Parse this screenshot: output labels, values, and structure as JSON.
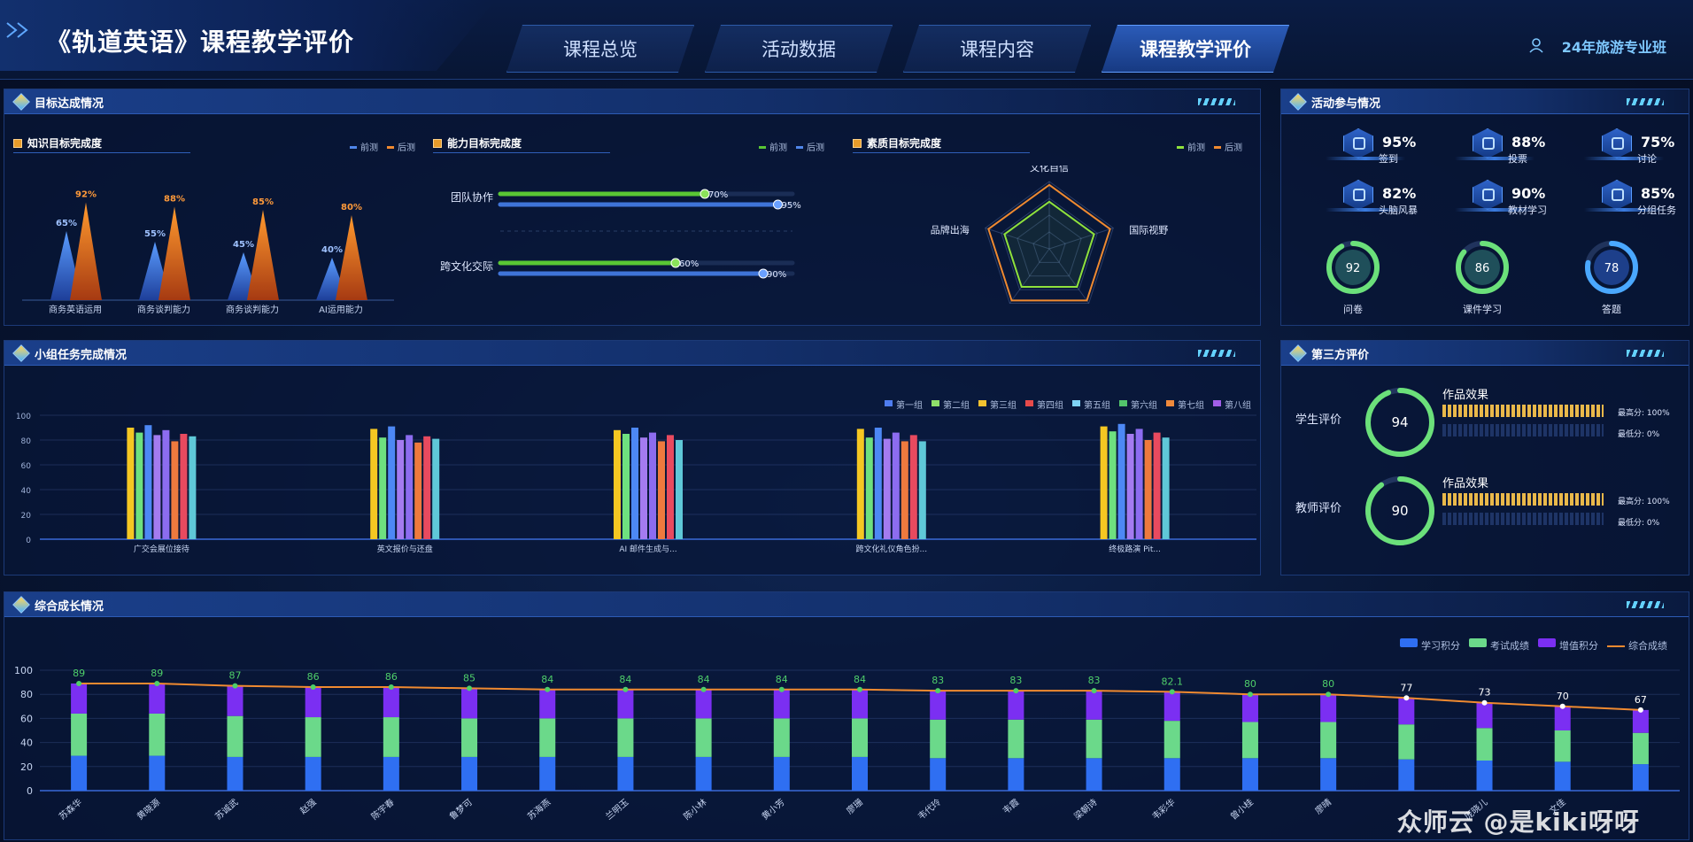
{
  "header": {
    "title": "《轨道英语》课程教学评价",
    "class_label": "24年旅游专业班",
    "tabs": [
      {
        "label": "课程总览"
      },
      {
        "label": "活动数据"
      },
      {
        "label": "课程内容"
      },
      {
        "label": "课程教学评价"
      }
    ]
  },
  "panels": {
    "goal": "目标达成情况",
    "activity": "活动参与情况",
    "group": "小组任务完成情况",
    "third": "第三方评价",
    "growth": "综合成长情况"
  },
  "knowledge": {
    "title": "知识目标完成度",
    "legend": [
      "前测",
      "后测"
    ],
    "chart_data": {
      "type": "bar",
      "categories": [
        "商务英语运用",
        "商务谈判能力",
        "商务谈判能力",
        "AI运用能力"
      ],
      "series": [
        {
          "name": "前测",
          "values": [
            65,
            55,
            45,
            40
          ]
        },
        {
          "name": "后测",
          "values": [
            92,
            88,
            85,
            80
          ]
        }
      ],
      "ylim": [
        0,
        100
      ]
    }
  },
  "ability": {
    "title": "能力目标完成度",
    "legend": [
      "前测",
      "后测"
    ],
    "chart_data": {
      "type": "bar",
      "categories": [
        "团队协作",
        "跨文化交际"
      ],
      "series": [
        {
          "name": "前测",
          "values": [
            70,
            60
          ]
        },
        {
          "name": "后测",
          "values": [
            95,
            90
          ]
        }
      ],
      "xlim": [
        0,
        100
      ]
    }
  },
  "quality": {
    "title": "素质目标完成度",
    "legend": [
      "前测",
      "后测"
    ],
    "chart_data": {
      "type": "radar",
      "indicators": [
        "文化自信",
        "国际视野",
        "",
        "",
        "品牌出海"
      ],
      "series": [
        {
          "name": "前测",
          "values": [
            70,
            70,
            70,
            70,
            70
          ]
        },
        {
          "name": "后测",
          "values": [
            95,
            95,
            95,
            95,
            95
          ]
        }
      ]
    }
  },
  "activity": {
    "stats": [
      {
        "value": "95%",
        "label": "签到",
        "icon": "signin-icon"
      },
      {
        "value": "88%",
        "label": "投票",
        "icon": "vote-icon"
      },
      {
        "value": "75%",
        "label": "讨论",
        "icon": "discussion-icon"
      },
      {
        "value": "82%",
        "label": "头脑风暴",
        "icon": "brainstorm-icon"
      },
      {
        "value": "90%",
        "label": "教材学习",
        "icon": "textbook-icon"
      },
      {
        "value": "85%",
        "label": "分组任务",
        "icon": "group-icon"
      }
    ],
    "rings": [
      {
        "value": "92",
        "label": "问卷",
        "level": 0.92
      },
      {
        "value": "86",
        "label": "课件学习",
        "level": 0.86
      },
      {
        "value": "78",
        "label": "答题",
        "level": 0.78
      }
    ]
  },
  "group_tasks": {
    "legend": [
      "第一组",
      "第二组",
      "第三组",
      "第四组",
      "第五组",
      "第六组",
      "第七组",
      "第八组"
    ],
    "colors": [
      "#4f7df0",
      "#8ee06a",
      "#f2c230",
      "#e74a4a",
      "#7fd3f5",
      "#52c46b",
      "#f08a3c",
      "#a15ee8"
    ],
    "bar_colors": [
      "#f5c722",
      "#6ee07f",
      "#4d88f5",
      "#a47bf0",
      "#8c6cf0",
      "#ee7a3e",
      "#e84a5f",
      "#5fc8d8"
    ],
    "chart_data": {
      "type": "bar",
      "categories": [
        "广交会展位接待",
        "英文报价与还盘",
        "AI 邮件生成与...",
        "跨文化礼仪角色扮...",
        "终极路演 Pit..."
      ],
      "series_values": [
        [
          90,
          86,
          92,
          84,
          88,
          79,
          85,
          83
        ],
        [
          89,
          82,
          91,
          80,
          84,
          78,
          83,
          81
        ],
        [
          88,
          85,
          90,
          82,
          86,
          79,
          84,
          80
        ],
        [
          89,
          82,
          90,
          81,
          86,
          79,
          84,
          79
        ],
        [
          91,
          87,
          93,
          85,
          89,
          80,
          86,
          82
        ]
      ],
      "yticks": [
        "100",
        "80",
        "60",
        "40",
        "20",
        "0"
      ],
      "ylim": [
        0,
        100
      ]
    }
  },
  "third_party": {
    "rows": [
      {
        "label": "学生评价",
        "score": "94",
        "level": 0.94,
        "metric": "作品效果",
        "max": "最高分: 100%",
        "min": "最低分: 0%"
      },
      {
        "label": "教师评价",
        "score": "90",
        "level": 0.9,
        "metric": "作品效果",
        "max": "最高分: 100%",
        "min": "最低分: 0%"
      }
    ]
  },
  "growth": {
    "legend": [
      "学习积分",
      "考试成绩",
      "增值积分",
      "综合成绩"
    ],
    "chart_data": {
      "type": "bar",
      "categories": [
        "苏森华",
        "黄晓源",
        "苏诚武",
        "赵强",
        "陈宇春",
        "鲁梦可",
        "苏海燕",
        "兰明玉",
        "陈小林",
        "黄小芳",
        "廖珊",
        "韦代玲",
        "韦霞",
        "梁朝诗",
        "韦彩华",
        "曾小桂",
        "廖晴",
        "",
        "庞晓儿",
        "文佳",
        ""
      ],
      "series": [
        {
          "name": "学习积分",
          "values": [
            29,
            29,
            28,
            28,
            28,
            28,
            28,
            28,
            28,
            28,
            28,
            27,
            27,
            27,
            27,
            27,
            27,
            26,
            25,
            24,
            22
          ]
        },
        {
          "name": "考试成绩",
          "values": [
            35,
            35,
            34,
            33,
            33,
            32,
            32,
            32,
            32,
            32,
            32,
            32,
            32,
            32,
            31,
            30,
            30,
            29,
            27,
            26,
            26
          ]
        },
        {
          "name": "增值积分",
          "values": [
            25,
            25,
            25,
            25,
            25,
            25,
            24,
            24,
            24,
            24,
            24,
            24,
            24,
            24,
            24,
            23,
            23,
            22,
            21,
            20,
            19
          ]
        },
        {
          "name": "综合成绩",
          "values": [
            89,
            89,
            87,
            86,
            86,
            85,
            84,
            84,
            84,
            84,
            84,
            83,
            83,
            83,
            82.1,
            80,
            80,
            77,
            73,
            70,
            67
          ]
        }
      ],
      "yticks": [
        "100",
        "80",
        "60",
        "40",
        "20",
        "0"
      ],
      "ylim": [
        0,
        100
      ]
    }
  },
  "watermark": "众师云 @是kiki呀呀"
}
